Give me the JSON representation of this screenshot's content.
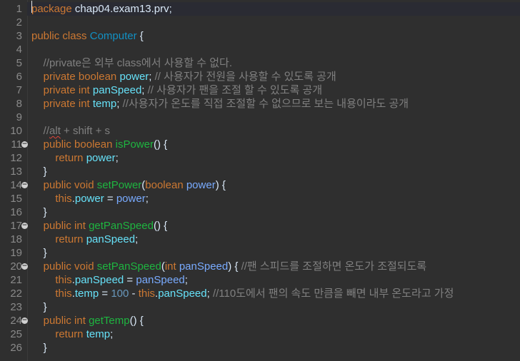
{
  "editor": {
    "lines": [
      {
        "num": "1",
        "fold": false,
        "tokens": [
          {
            "t": "package",
            "c": "kw"
          },
          {
            "t": " chap04.exam13.prv;",
            "c": "txt"
          }
        ]
      },
      {
        "num": "2",
        "fold": false,
        "tokens": []
      },
      {
        "num": "3",
        "fold": false,
        "tokens": [
          {
            "t": "public",
            "c": "kw"
          },
          {
            "t": " ",
            "c": "txt"
          },
          {
            "t": "class",
            "c": "kw"
          },
          {
            "t": " ",
            "c": "txt"
          },
          {
            "t": "Computer",
            "c": "cls"
          },
          {
            "t": " {",
            "c": "txt"
          }
        ]
      },
      {
        "num": "4",
        "fold": false,
        "tokens": []
      },
      {
        "num": "5",
        "fold": false,
        "tokens": [
          {
            "t": "    //private은 외부 class에서 사용할 수 없다.",
            "c": "cmt"
          }
        ]
      },
      {
        "num": "6",
        "fold": false,
        "tokens": [
          {
            "t": "    ",
            "c": "txt"
          },
          {
            "t": "private",
            "c": "kw"
          },
          {
            "t": " ",
            "c": "txt"
          },
          {
            "t": "boolean",
            "c": "kw"
          },
          {
            "t": " ",
            "c": "txt"
          },
          {
            "t": "power",
            "c": "fld"
          },
          {
            "t": "; ",
            "c": "txt"
          },
          {
            "t": "// 사용자가 전원을 사용할 수 있도록 공개",
            "c": "cmt"
          }
        ]
      },
      {
        "num": "7",
        "fold": false,
        "tokens": [
          {
            "t": "    ",
            "c": "txt"
          },
          {
            "t": "private",
            "c": "kw"
          },
          {
            "t": " ",
            "c": "txt"
          },
          {
            "t": "int",
            "c": "kw"
          },
          {
            "t": " ",
            "c": "txt"
          },
          {
            "t": "panSpeed",
            "c": "fld"
          },
          {
            "t": "; ",
            "c": "txt"
          },
          {
            "t": "// 사용자가 팬을 조절 할 수 있도록 공개",
            "c": "cmt"
          }
        ]
      },
      {
        "num": "8",
        "fold": false,
        "tokens": [
          {
            "t": "    ",
            "c": "txt"
          },
          {
            "t": "private",
            "c": "kw"
          },
          {
            "t": " ",
            "c": "txt"
          },
          {
            "t": "int",
            "c": "kw"
          },
          {
            "t": " ",
            "c": "txt"
          },
          {
            "t": "temp",
            "c": "fld"
          },
          {
            "t": "; ",
            "c": "txt"
          },
          {
            "t": "//사용자가 온도를 직접 조절할 수 없으므로 보는 내용이라도 공개",
            "c": "cmt"
          }
        ]
      },
      {
        "num": "9",
        "fold": false,
        "tokens": []
      },
      {
        "num": "10",
        "fold": false,
        "tokens": [
          {
            "t": "    //",
            "c": "cmt"
          },
          {
            "t": "alt",
            "c": "cmt squig"
          },
          {
            "t": " + shift + s",
            "c": "cmt"
          }
        ]
      },
      {
        "num": "11",
        "fold": true,
        "tokens": [
          {
            "t": "    ",
            "c": "txt"
          },
          {
            "t": "public",
            "c": "kw"
          },
          {
            "t": " ",
            "c": "txt"
          },
          {
            "t": "boolean",
            "c": "kw"
          },
          {
            "t": " ",
            "c": "txt"
          },
          {
            "t": "isPower",
            "c": "mth"
          },
          {
            "t": "() {",
            "c": "txt"
          }
        ]
      },
      {
        "num": "12",
        "fold": false,
        "tokens": [
          {
            "t": "        ",
            "c": "txt"
          },
          {
            "t": "return",
            "c": "kw"
          },
          {
            "t": " ",
            "c": "txt"
          },
          {
            "t": "power",
            "c": "fld"
          },
          {
            "t": ";",
            "c": "txt"
          }
        ]
      },
      {
        "num": "13",
        "fold": false,
        "tokens": [
          {
            "t": "    }",
            "c": "txt"
          }
        ]
      },
      {
        "num": "14",
        "fold": true,
        "tokens": [
          {
            "t": "    ",
            "c": "txt"
          },
          {
            "t": "public",
            "c": "kw"
          },
          {
            "t": " ",
            "c": "txt"
          },
          {
            "t": "void",
            "c": "kw"
          },
          {
            "t": " ",
            "c": "txt"
          },
          {
            "t": "setPower",
            "c": "mth"
          },
          {
            "t": "(",
            "c": "txt"
          },
          {
            "t": "boolean",
            "c": "kw"
          },
          {
            "t": " ",
            "c": "txt"
          },
          {
            "t": "power",
            "c": "par"
          },
          {
            "t": ") {",
            "c": "txt"
          }
        ]
      },
      {
        "num": "15",
        "fold": false,
        "tokens": [
          {
            "t": "        ",
            "c": "txt"
          },
          {
            "t": "this",
            "c": "kw"
          },
          {
            "t": ".",
            "c": "txt"
          },
          {
            "t": "power",
            "c": "fld"
          },
          {
            "t": " = ",
            "c": "txt"
          },
          {
            "t": "power",
            "c": "par"
          },
          {
            "t": ";",
            "c": "txt"
          }
        ]
      },
      {
        "num": "16",
        "fold": false,
        "tokens": [
          {
            "t": "    }",
            "c": "txt"
          }
        ]
      },
      {
        "num": "17",
        "fold": true,
        "tokens": [
          {
            "t": "    ",
            "c": "txt"
          },
          {
            "t": "public",
            "c": "kw"
          },
          {
            "t": " ",
            "c": "txt"
          },
          {
            "t": "int",
            "c": "kw"
          },
          {
            "t": " ",
            "c": "txt"
          },
          {
            "t": "getPanSpeed",
            "c": "mth"
          },
          {
            "t": "() {",
            "c": "txt"
          }
        ]
      },
      {
        "num": "18",
        "fold": false,
        "tokens": [
          {
            "t": "        ",
            "c": "txt"
          },
          {
            "t": "return",
            "c": "kw"
          },
          {
            "t": " ",
            "c": "txt"
          },
          {
            "t": "panSpeed",
            "c": "fld"
          },
          {
            "t": ";",
            "c": "txt"
          }
        ]
      },
      {
        "num": "19",
        "fold": false,
        "tokens": [
          {
            "t": "    }",
            "c": "txt"
          }
        ]
      },
      {
        "num": "20",
        "fold": true,
        "tokens": [
          {
            "t": "    ",
            "c": "txt"
          },
          {
            "t": "public",
            "c": "kw"
          },
          {
            "t": " ",
            "c": "txt"
          },
          {
            "t": "void",
            "c": "kw"
          },
          {
            "t": " ",
            "c": "txt"
          },
          {
            "t": "setPanSpeed",
            "c": "mth"
          },
          {
            "t": "(",
            "c": "txt"
          },
          {
            "t": "int",
            "c": "kw"
          },
          {
            "t": " ",
            "c": "txt"
          },
          {
            "t": "panSpeed",
            "c": "par"
          },
          {
            "t": ") { ",
            "c": "txt"
          },
          {
            "t": "//팬 스피드를 조절하면 온도가 조절되도록",
            "c": "cmt"
          }
        ]
      },
      {
        "num": "21",
        "fold": false,
        "tokens": [
          {
            "t": "        ",
            "c": "txt"
          },
          {
            "t": "this",
            "c": "kw"
          },
          {
            "t": ".",
            "c": "txt"
          },
          {
            "t": "panSpeed",
            "c": "fld"
          },
          {
            "t": " = ",
            "c": "txt"
          },
          {
            "t": "panSpeed",
            "c": "par"
          },
          {
            "t": ";",
            "c": "txt"
          }
        ]
      },
      {
        "num": "22",
        "fold": false,
        "tokens": [
          {
            "t": "        ",
            "c": "txt"
          },
          {
            "t": "this",
            "c": "kw"
          },
          {
            "t": ".",
            "c": "txt"
          },
          {
            "t": "temp",
            "c": "fld"
          },
          {
            "t": " = ",
            "c": "txt"
          },
          {
            "t": "100",
            "c": "num"
          },
          {
            "t": " - ",
            "c": "txt"
          },
          {
            "t": "this",
            "c": "kw"
          },
          {
            "t": ".",
            "c": "txt"
          },
          {
            "t": "panSpeed",
            "c": "fld"
          },
          {
            "t": "; ",
            "c": "txt"
          },
          {
            "t": "//110도에서 팬의 속도 만큼을 빼면 내부 온도라고 가정",
            "c": "cmt"
          }
        ]
      },
      {
        "num": "23",
        "fold": false,
        "tokens": [
          {
            "t": "    }",
            "c": "txt"
          }
        ]
      },
      {
        "num": "24",
        "fold": true,
        "tokens": [
          {
            "t": "    ",
            "c": "txt"
          },
          {
            "t": "public",
            "c": "kw"
          },
          {
            "t": " ",
            "c": "txt"
          },
          {
            "t": "int",
            "c": "kw"
          },
          {
            "t": " ",
            "c": "txt"
          },
          {
            "t": "getTemp",
            "c": "mth"
          },
          {
            "t": "() {",
            "c": "txt"
          }
        ]
      },
      {
        "num": "25",
        "fold": false,
        "tokens": [
          {
            "t": "        ",
            "c": "txt"
          },
          {
            "t": "return",
            "c": "kw"
          },
          {
            "t": " ",
            "c": "txt"
          },
          {
            "t": "temp",
            "c": "fld"
          },
          {
            "t": ";",
            "c": "txt"
          }
        ]
      },
      {
        "num": "26",
        "fold": false,
        "tokens": [
          {
            "t": "    }",
            "c": "txt"
          }
        ]
      }
    ]
  }
}
